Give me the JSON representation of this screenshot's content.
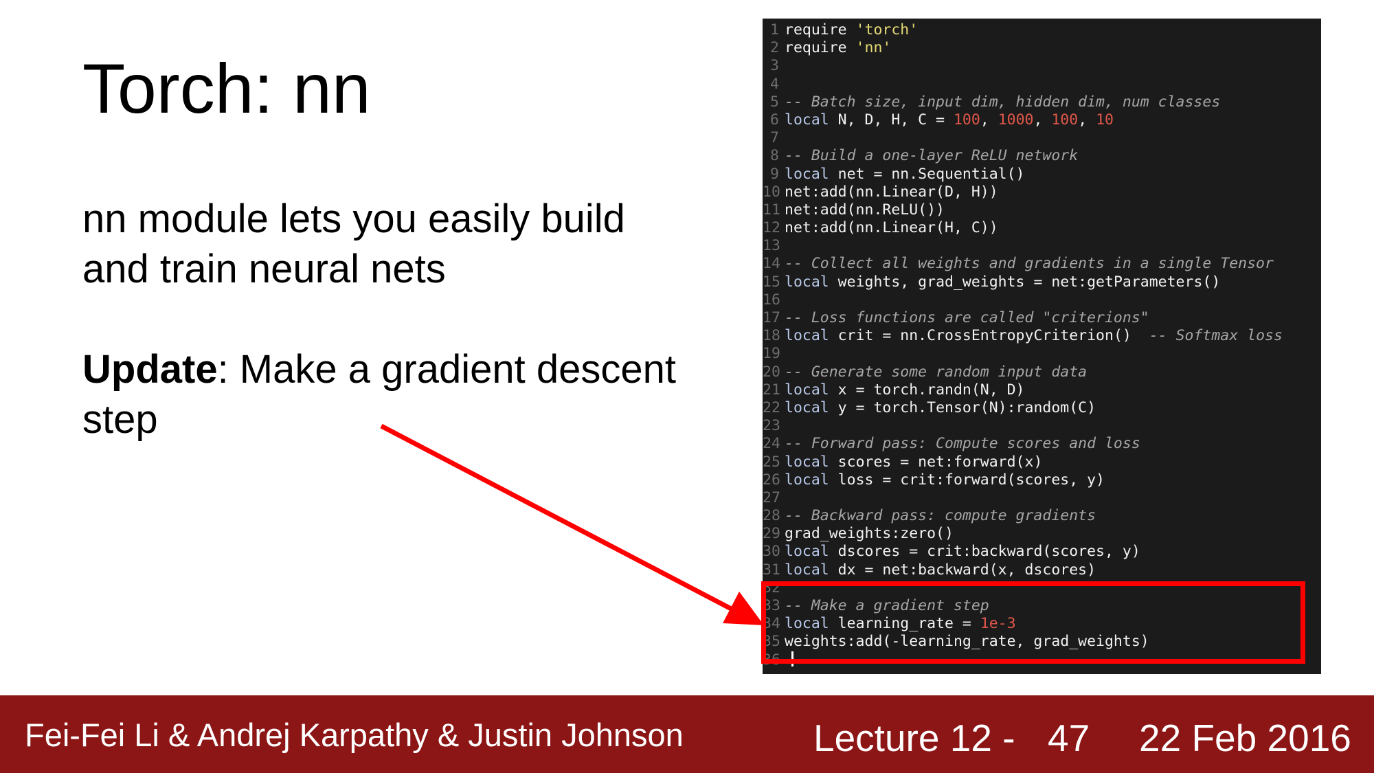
{
  "slide": {
    "title": "Torch: nn",
    "paragraph1": "nn module lets you easily build and train neural nets",
    "update_bold": "Update",
    "update_rest": ": Make a gradient descent step"
  },
  "code": {
    "lines": [
      [
        {
          "t": "require ",
          "c": "plain"
        },
        {
          "t": "'torch'",
          "c": "str"
        }
      ],
      [
        {
          "t": "require ",
          "c": "plain"
        },
        {
          "t": "'nn'",
          "c": "str"
        }
      ],
      [],
      [],
      [
        {
          "t": "-- Batch size, input dim, hidden dim, num classes",
          "c": "cmt"
        }
      ],
      [
        {
          "t": "local",
          "c": "kw"
        },
        {
          "t": " N, D, H, C = ",
          "c": "plain"
        },
        {
          "t": "100",
          "c": "num"
        },
        {
          "t": ", ",
          "c": "plain"
        },
        {
          "t": "1000",
          "c": "num"
        },
        {
          "t": ", ",
          "c": "plain"
        },
        {
          "t": "100",
          "c": "num"
        },
        {
          "t": ", ",
          "c": "plain"
        },
        {
          "t": "10",
          "c": "num"
        }
      ],
      [],
      [
        {
          "t": "-- Build a one-layer ReLU network",
          "c": "cmt"
        }
      ],
      [
        {
          "t": "local",
          "c": "kw"
        },
        {
          "t": " net = nn.Sequential()",
          "c": "plain"
        }
      ],
      [
        {
          "t": "net:add(nn.Linear(D, H))",
          "c": "plain"
        }
      ],
      [
        {
          "t": "net:add(nn.ReLU())",
          "c": "plain"
        }
      ],
      [
        {
          "t": "net:add(nn.Linear(H, C))",
          "c": "plain"
        }
      ],
      [],
      [
        {
          "t": "-- Collect all weights and gradients in a single Tensor",
          "c": "cmt"
        }
      ],
      [
        {
          "t": "local",
          "c": "kw"
        },
        {
          "t": " weights, grad_weights = net:getParameters()",
          "c": "plain"
        }
      ],
      [],
      [
        {
          "t": "-- Loss functions are called \"criterions\"",
          "c": "cmt"
        }
      ],
      [
        {
          "t": "local",
          "c": "kw"
        },
        {
          "t": " crit = nn.CrossEntropyCriterion()  ",
          "c": "plain"
        },
        {
          "t": "-- Softmax loss",
          "c": "cmt"
        }
      ],
      [],
      [
        {
          "t": "-- Generate some random input data",
          "c": "cmt"
        }
      ],
      [
        {
          "t": "local",
          "c": "kw"
        },
        {
          "t": " x = torch.randn(N, D)",
          "c": "plain"
        }
      ],
      [
        {
          "t": "local",
          "c": "kw"
        },
        {
          "t": " y = torch.Tensor(N):random(C)",
          "c": "plain"
        }
      ],
      [],
      [
        {
          "t": "-- Forward pass: Compute scores and loss",
          "c": "cmt"
        }
      ],
      [
        {
          "t": "local",
          "c": "kw"
        },
        {
          "t": " scores = net:forward(x)",
          "c": "plain"
        }
      ],
      [
        {
          "t": "local",
          "c": "kw"
        },
        {
          "t": " loss = crit:forward(scores, y)",
          "c": "plain"
        }
      ],
      [],
      [
        {
          "t": "-- Backward pass: compute gradients",
          "c": "cmt"
        }
      ],
      [
        {
          "t": "grad_weights:zero()",
          "c": "plain"
        }
      ],
      [
        {
          "t": "local",
          "c": "kw"
        },
        {
          "t": " dscores = crit:backward(scores, y)",
          "c": "plain"
        }
      ],
      [
        {
          "t": "local",
          "c": "kw"
        },
        {
          "t": " dx = net:backward(x, dscores)",
          "c": "plain"
        }
      ],
      [],
      [
        {
          "t": "-- Make a gradient step",
          "c": "cmt"
        }
      ],
      [
        {
          "t": "local",
          "c": "kw"
        },
        {
          "t": " learning_rate = ",
          "c": "plain"
        },
        {
          "t": "1e-3",
          "c": "num"
        }
      ],
      [
        {
          "t": "weights:add(-learning_rate, grad_weights)",
          "c": "plain"
        }
      ],
      []
    ]
  },
  "footer": {
    "authors": "Fei-Fei Li & Andrej Karpathy & Justin Johnson",
    "lecture": "Lecture 12 -",
    "page": "47",
    "date": "22 Feb 2016"
  },
  "colors": {
    "footer_bg": "#8c1515",
    "highlight": "#ff0000",
    "code_bg": "#1b1b1b"
  }
}
